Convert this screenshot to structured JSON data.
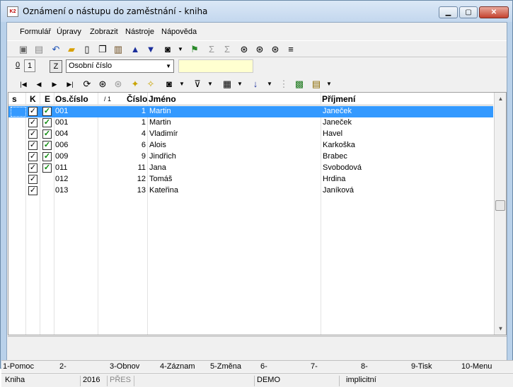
{
  "window": {
    "title": "Oznámení o nástupu do zaměstnání - kniha",
    "app_icon_text": "K2"
  },
  "menu": [
    {
      "label": "Formulář"
    },
    {
      "label": "Úpravy"
    },
    {
      "label": "Zobrazit"
    },
    {
      "label": "Nástroje"
    },
    {
      "label": "Nápověda"
    }
  ],
  "tabs": {
    "tab0": "0",
    "tab1": "1",
    "z_button": "Z"
  },
  "sort_select": {
    "value": "Osobní číslo"
  },
  "grid": {
    "headers": {
      "s": "s",
      "k": "K",
      "e": "E",
      "os_cislo": "Os.číslo",
      "sort_mark": "/ 1",
      "cislo": "Číslo",
      "jmeno": "Jméno",
      "prijmeni": "Příjmení"
    },
    "rows": [
      {
        "k": true,
        "e": true,
        "os_cislo": "001",
        "cislo": "1",
        "jmeno": "Martin",
        "prijmeni": "Janeček"
      },
      {
        "k": true,
        "e": true,
        "os_cislo": "001",
        "cislo": "1",
        "jmeno": "Martin",
        "prijmeni": "Janeček"
      },
      {
        "k": true,
        "e": true,
        "os_cislo": "004",
        "cislo": "4",
        "jmeno": "Vladimír",
        "prijmeni": "Havel"
      },
      {
        "k": true,
        "e": true,
        "os_cislo": "006",
        "cislo": "6",
        "jmeno": "Alois",
        "prijmeni": "Karkoška"
      },
      {
        "k": true,
        "e": true,
        "os_cislo": "009",
        "cislo": "9",
        "jmeno": "Jindřich",
        "prijmeni": "Brabec"
      },
      {
        "k": true,
        "e": true,
        "os_cislo": "011",
        "cislo": "11",
        "jmeno": "Jana",
        "prijmeni": "Svobodová"
      },
      {
        "k": true,
        "e": false,
        "os_cislo": "012",
        "cislo": "12",
        "jmeno": "Tomáš",
        "prijmeni": "Hrdina"
      },
      {
        "k": true,
        "e": false,
        "os_cislo": "013",
        "cislo": "13",
        "jmeno": "Kateřina",
        "prijmeni": "Janíková"
      }
    ],
    "selected_row": 0
  },
  "function_keys": [
    "1-Pomoc",
    "2-",
    "3-Obnov",
    "4-Záznam",
    "5-Změna",
    "6-",
    "7-",
    "8-",
    "9-Tisk",
    "10-Menu"
  ],
  "status": {
    "book": "Kniha",
    "year": "2016",
    "mode": "PŘES",
    "db": "DEMO",
    "profile": "implicitní"
  },
  "icons": {
    "toolbar1": [
      "save-icon",
      "save-all-icon",
      "undo-icon",
      "open-folder-icon",
      "new-document-icon",
      "copy-icon",
      "book-icon",
      "arrow-up-icon",
      "arrow-down-icon",
      "camera-icon",
      "filter-add-icon",
      "sum-icon",
      "sum-group-icon",
      "binoculars-icon",
      "binoculars-next-icon",
      "binoculars-settings-icon",
      "list-icon"
    ],
    "toolbar2": [
      "first-record-icon",
      "prev-record-icon",
      "next-record-icon",
      "last-record-icon",
      "refresh-icon",
      "search-icon",
      "search-next-icon",
      "add-star-icon",
      "remove-star-icon",
      "camera-icon",
      "filter-icon",
      "columns-icon",
      "sort-icon",
      "group-icon",
      "export-excel-icon",
      "report-icon"
    ]
  }
}
